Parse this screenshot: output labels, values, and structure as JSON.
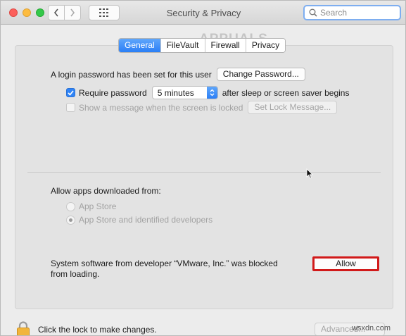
{
  "window": {
    "title": "Security & Privacy"
  },
  "toolbar": {
    "back_icon": "chevron-left-icon",
    "forward_icon": "chevron-right-icon",
    "grid_icon": "grid-icon"
  },
  "search": {
    "placeholder": "Search",
    "value": ""
  },
  "tabs": [
    {
      "label": "General",
      "active": true
    },
    {
      "label": "FileVault",
      "active": false
    },
    {
      "label": "Firewall",
      "active": false
    },
    {
      "label": "Privacy",
      "active": false
    }
  ],
  "general": {
    "login_text": "A login password has been set for this user",
    "change_password_label": "Change Password...",
    "require_password_label": "Require password",
    "require_password_checked": true,
    "require_password_delay": "5 minutes",
    "require_password_suffix": "after sleep or screen saver begins",
    "show_message_label": "Show a message when the screen is locked",
    "show_message_checked": false,
    "set_lock_message_label": "Set Lock Message..."
  },
  "downloads": {
    "heading": "Allow apps downloaded from:",
    "options": [
      {
        "label": "App Store",
        "selected": false
      },
      {
        "label": "App Store and identified developers",
        "selected": true
      }
    ]
  },
  "blocked": {
    "line1": "System software from developer “VMware, Inc.” was blocked",
    "line2": "from loading.",
    "allow_label": "Allow"
  },
  "footer": {
    "lock_text": "Click the lock to make changes.",
    "advanced_label": "Advanced..."
  },
  "watermark": {
    "logo": "APPUALS",
    "site": "wsxdn.com"
  },
  "colors": {
    "accent": "#2b7ff6",
    "highlight_border": "#d11a1a"
  }
}
